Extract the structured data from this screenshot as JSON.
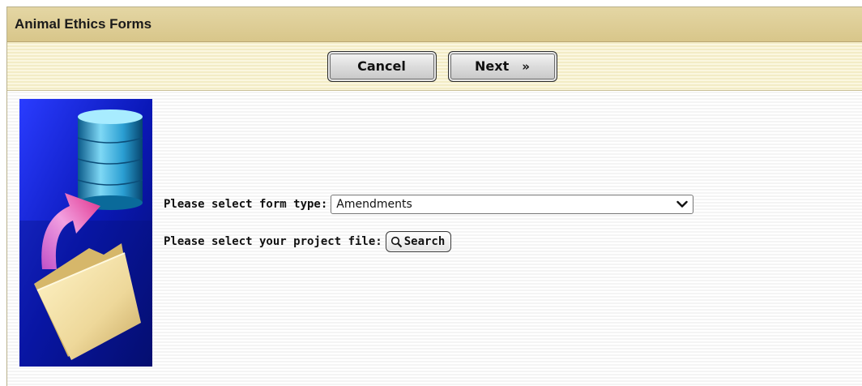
{
  "header": {
    "title": "Animal Ethics Forms"
  },
  "toolbar": {
    "cancel_label": "Cancel",
    "next_label": "Next",
    "next_glyph": "»"
  },
  "form": {
    "form_type_label": "Please select form type:",
    "form_type_value": "Amendments",
    "project_file_label": "Please select your project file:",
    "search_label": "Search"
  },
  "icons": {
    "next": "double-chevron-right-icon",
    "dropdown": "chevron-down-icon",
    "search": "magnifier-icon",
    "illustration": "database-folder-illustration"
  },
  "colors": {
    "header_bg": "#dccb90",
    "toolbar_bg": "#f6f0d0",
    "illustration_bg": "#1020c0"
  }
}
